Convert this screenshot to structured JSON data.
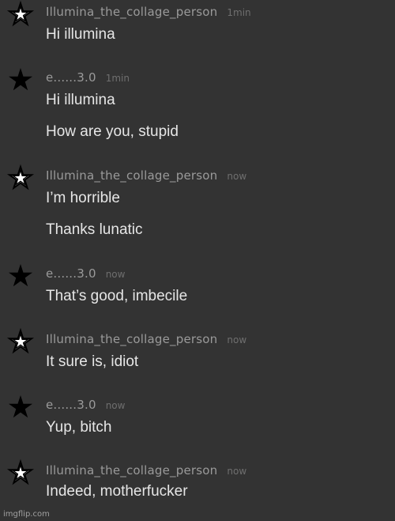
{
  "messages": [
    {
      "avatar_icon": "outline-star-icon",
      "username": "Illumina_the_collage_person",
      "time": "1min",
      "lines": [
        "Hi illumina"
      ]
    },
    {
      "avatar_icon": "black-star-icon",
      "username": "e......3.0",
      "time": "1min",
      "lines": [
        "Hi illumina",
        "How are you, stupid"
      ]
    },
    {
      "avatar_icon": "outline-star-icon",
      "username": "Illumina_the_collage_person",
      "time": "now",
      "lines": [
        "I’m horrible",
        "Thanks lunatic"
      ]
    },
    {
      "avatar_icon": "black-star-icon",
      "username": "e......3.0",
      "time": "now",
      "lines": [
        "That’s good, imbecile"
      ]
    },
    {
      "avatar_icon": "outline-star-icon",
      "username": "Illumina_the_collage_person",
      "time": "now",
      "lines": [
        "It sure is, idiot"
      ]
    },
    {
      "avatar_icon": "black-star-icon",
      "username": "e......3.0",
      "time": "now",
      "lines": [
        "Yup, bitch"
      ]
    },
    {
      "avatar_icon": "outline-star-icon",
      "username": "Illumina_the_collage_person",
      "time": "now",
      "lines": [
        "Indeed, motherfucker"
      ]
    }
  ],
  "watermark": "imgflip.com",
  "colors": {
    "background": "#333333",
    "username": "#9a9a9a",
    "timestamp": "#6f6f6f",
    "message": "#e6e6e6"
  }
}
